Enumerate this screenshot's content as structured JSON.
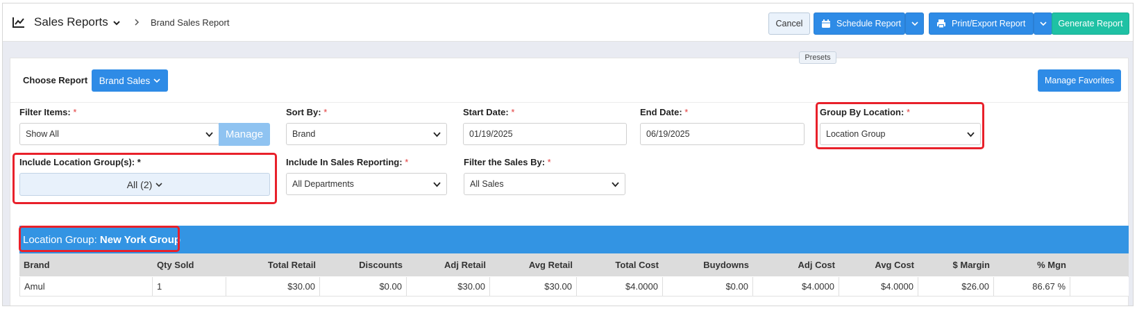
{
  "header": {
    "section_title": "Sales Reports",
    "breadcrumb": "Brand Sales Report",
    "cancel_label": "Cancel",
    "schedule_label": "Schedule Report",
    "print_label": "Print/Export Report",
    "generate_label": "Generate Report"
  },
  "report": {
    "choose_label": "Choose Report",
    "selected_report": "Brand Sales",
    "manage_favorites_label": "Manage Favorites"
  },
  "filters": {
    "filter_items_label": "Filter Items:",
    "filter_items_value": "Show All",
    "manage_label": "Manage",
    "sort_by_label": "Sort By:",
    "sort_by_value": "Brand",
    "start_date_label": "Start Date:",
    "start_date_value": "01/19/2025",
    "end_date_label": "End Date:",
    "end_date_value": "06/19/2025",
    "presets_label": "Presets",
    "group_by_label": "Group By Location:",
    "group_by_value": "Location Group",
    "include_groups_label": "Include Location Group(s): *",
    "include_groups_value": "All (2)",
    "include_sales_label": "Include In Sales Reporting:",
    "include_sales_value": "All Departments",
    "filter_sales_label": "Filter the Sales By:",
    "filter_sales_value": "All Sales",
    "required_mark": "*"
  },
  "results": {
    "group_prefix": "Location Group: ",
    "group_name": "New York Group",
    "columns": [
      "Brand",
      "Qty Sold",
      "Total Retail",
      "Discounts",
      "Adj Retail",
      "Avg Retail",
      "Total Cost",
      "Buydowns",
      "Adj Cost",
      "Avg Cost",
      "$ Margin",
      "% Mgn"
    ],
    "rows": [
      [
        "Amul",
        "1",
        "$30.00",
        "$0.00",
        "$30.00",
        "$30.00",
        "$4.0000",
        "$0.00",
        "$4.0000",
        "$4.0000",
        "$26.00",
        "86.67 %"
      ]
    ]
  },
  "colors": {
    "primary_blue": "#2e8be6",
    "generate_teal": "#1fc1a4",
    "group_bar_blue": "#3394e3",
    "highlight_red": "#e8202a"
  }
}
